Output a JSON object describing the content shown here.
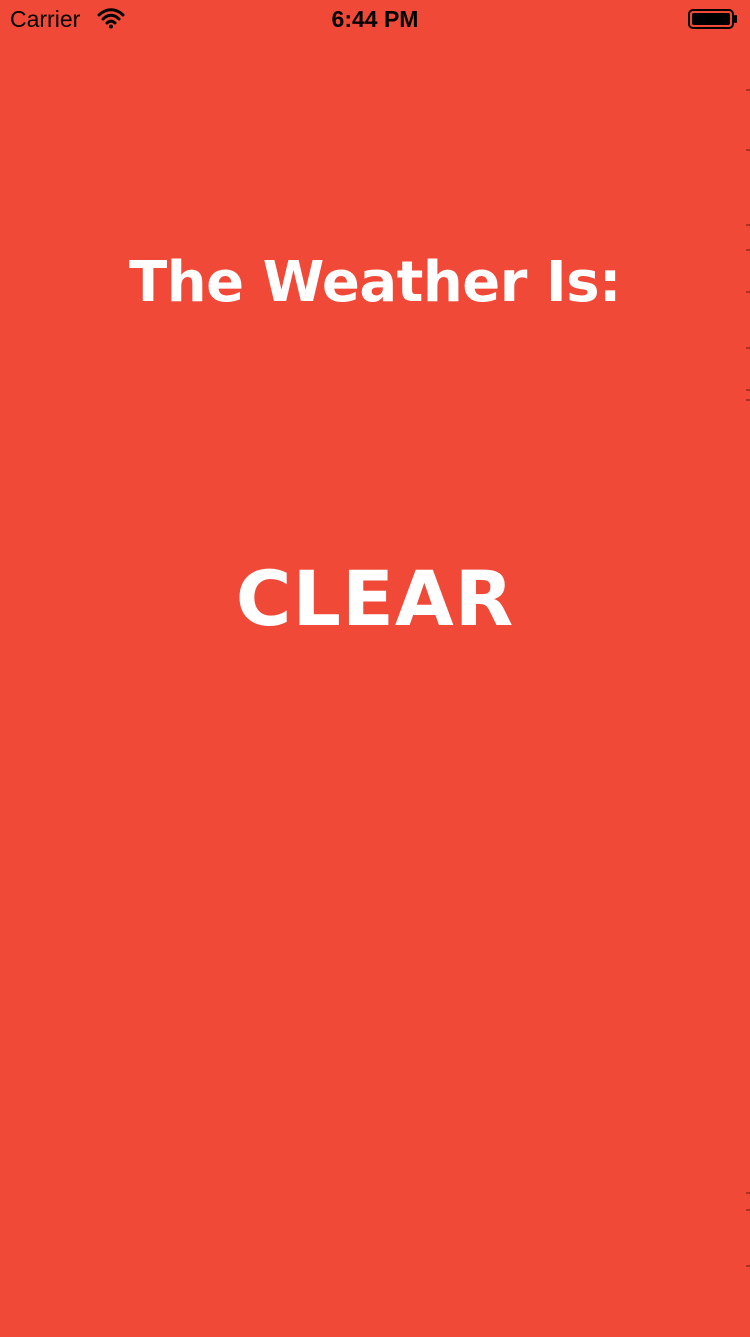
{
  "status_bar": {
    "carrier": "Carrier",
    "time": "6:44 PM",
    "signal_icon": "wifi-icon",
    "battery_icon": "battery-icon"
  },
  "main": {
    "heading": "The Weather Is:",
    "condition": "CLEAR"
  },
  "colors": {
    "background": "#f04937",
    "text": "#ffffff",
    "status_text": "#000000"
  }
}
